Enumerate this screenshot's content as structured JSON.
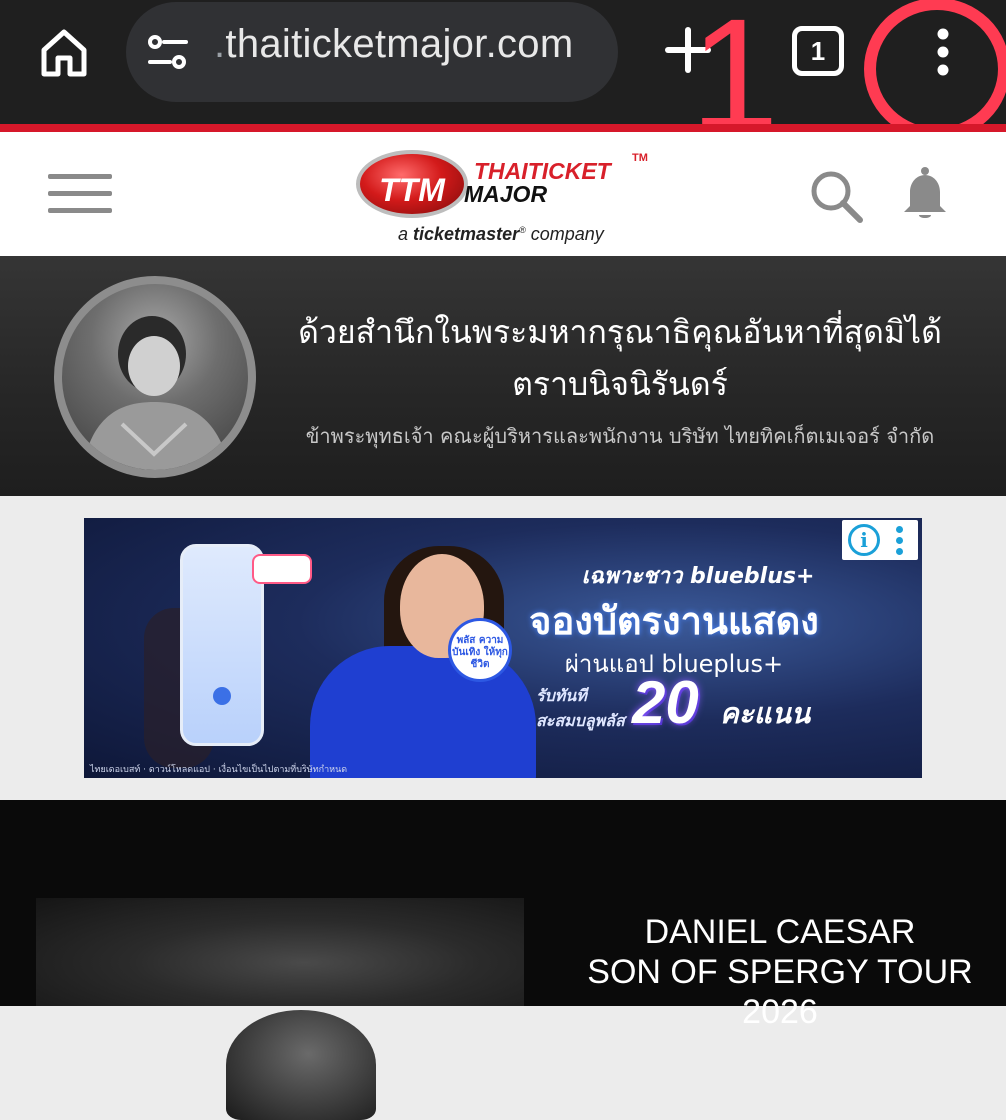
{
  "browser": {
    "url_prefix": ".",
    "url_main": "thaiticketmajor.com",
    "tab_count": "1",
    "annotation": {
      "number": "1",
      "color": "#ff3b52"
    },
    "icons": [
      "home-icon",
      "tune-icon",
      "plus-icon",
      "tabs-icon",
      "more-vert-icon"
    ]
  },
  "site": {
    "logo_badge": "TTM",
    "logo_line1": "THAITICKET",
    "logo_tm": "TM",
    "logo_line2": "MAJOR",
    "logo_tagline_prefix": "a",
    "logo_tagline_brand": "ticketmaster",
    "logo_tagline_reg": "®",
    "logo_tagline_suffix": "company",
    "accent_color": "#d8202a",
    "icons": [
      "menu-icon",
      "search-icon",
      "bell-icon"
    ]
  },
  "memorial": {
    "title_line1": "ด้วยสำนึกในพระมหากรุณาธิคุณอันหาที่สุดมิได้",
    "title_line2": "ตราบนิจนิรันดร์",
    "subtitle": "ข้าพระพุทธเจ้า คณะผู้บริหารและพนักงาน บริษัท ไทยทิคเก็ตเมเจอร์ จำกัด"
  },
  "ad": {
    "line1": "เฉพาะชาว blueblus+",
    "line2": "จองบัตรงานแสดง",
    "line3": "ผ่านแอป blueplus+",
    "line4a": "รับทันที",
    "line4b": "สะสมบลูพลัส",
    "points_number": "20",
    "points_label": "คะแนน",
    "bubble_text": "พลัส ความบันเทิง ให้ทุกชีวิต",
    "info_icon": "i",
    "footer_note": "ไทยเดอเบสท์ · ดาวน์โหลดแอป · เงื่อนไขเป็นไปตามที่บริษัทกำหนด",
    "colors": {
      "brand_blue": "#1f3fd1",
      "info_blue": "#1aa0d8"
    }
  },
  "event": {
    "title_line1": "DANIEL CAESAR",
    "title_line2": "SON OF SPERGY TOUR",
    "title_line3": "2026"
  }
}
